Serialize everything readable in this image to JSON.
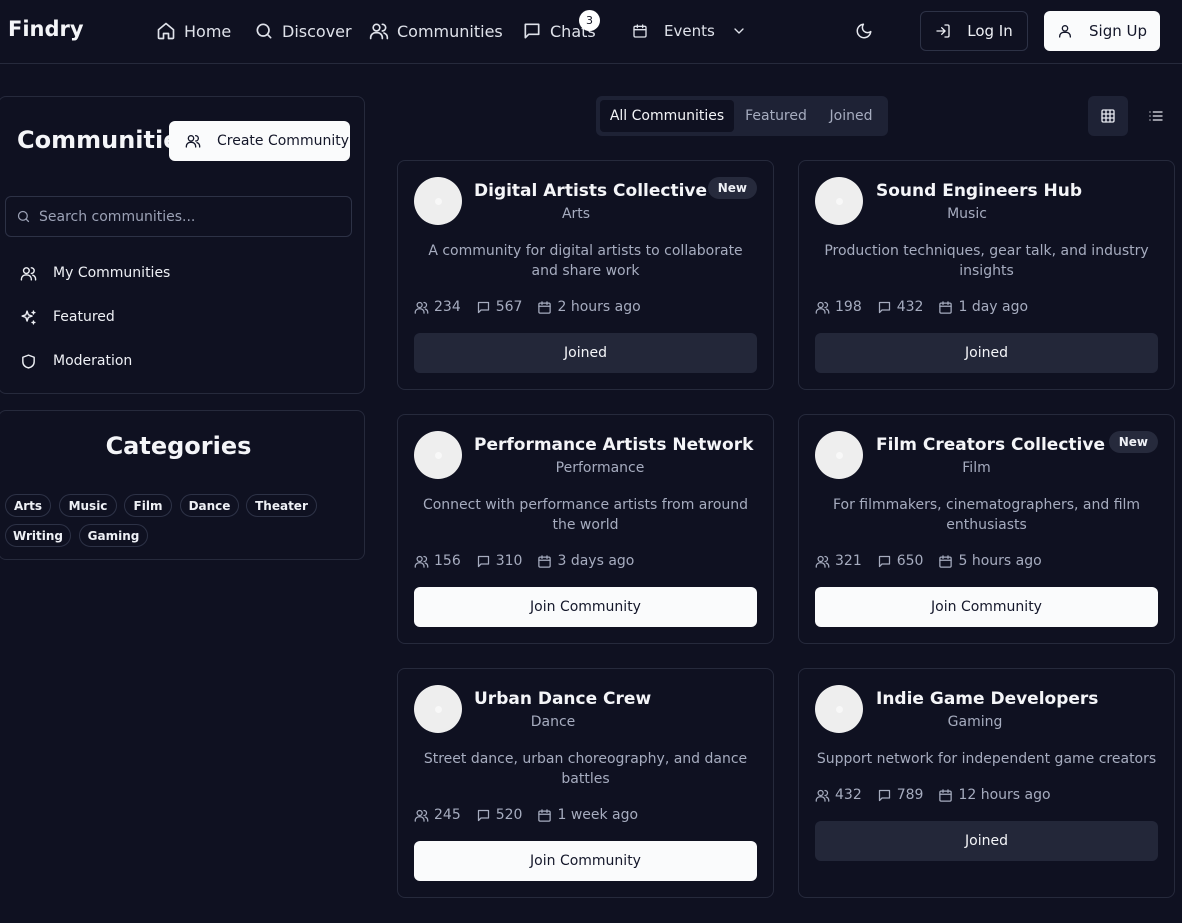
{
  "brand": "Findry",
  "nav": {
    "home": "Home",
    "discover": "Discover",
    "communities": "Communities",
    "chats": "Chats",
    "chats_badge": "3",
    "events": "Events"
  },
  "auth": {
    "login": "Log In",
    "signup": "Sign Up"
  },
  "sidebar": {
    "title": "Communities",
    "create_button": "Create Community",
    "search_placeholder": "Search communities...",
    "items": [
      {
        "label": "My Communities",
        "icon": "users-icon"
      },
      {
        "label": "Featured",
        "icon": "sparkles-icon"
      },
      {
        "label": "Moderation",
        "icon": "shield-icon"
      }
    ]
  },
  "categories": {
    "title": "Categories",
    "chips": [
      "Arts",
      "Music",
      "Film",
      "Dance",
      "Theater",
      "Writing",
      "Gaming"
    ]
  },
  "tabs": [
    "All Communities",
    "Featured",
    "Joined"
  ],
  "active_tab": "All Communities",
  "view_mode": "grid",
  "cards": [
    {
      "name": "Digital Artists Collective",
      "category": "Arts",
      "new": "New",
      "description": "A community for digital artists to collaborate and share work",
      "members": "234",
      "posts": "567",
      "time": "2 hours ago",
      "button": "Joined",
      "joined": true
    },
    {
      "name": "Sound Engineers Hub",
      "category": "Music",
      "new": "",
      "description": "Production techniques, gear talk, and industry insights",
      "members": "198",
      "posts": "432",
      "time": "1 day ago",
      "button": "Joined",
      "joined": true
    },
    {
      "name": "Performance Artists Network",
      "category": "Performance",
      "new": "",
      "description": "Connect with performance artists from around the world",
      "members": "156",
      "posts": "310",
      "time": "3 days ago",
      "button": "Join Community",
      "joined": false
    },
    {
      "name": "Film Creators Collective",
      "category": "Film",
      "new": "New",
      "description": "For filmmakers, cinematographers, and film enthusiasts",
      "members": "321",
      "posts": "650",
      "time": "5 hours ago",
      "button": "Join Community",
      "joined": false
    },
    {
      "name": "Urban Dance Crew",
      "category": "Dance",
      "new": "",
      "description": "Street dance, urban choreography, and dance battles",
      "members": "245",
      "posts": "520",
      "time": "1 week ago",
      "button": "Join Community",
      "joined": false
    },
    {
      "name": "Indie Game Developers",
      "category": "Gaming",
      "new": "",
      "description": "Support network for independent game creators",
      "members": "432",
      "posts": "789",
      "time": "12 hours ago",
      "button": "Joined",
      "joined": true
    }
  ],
  "colors": {
    "background": "#0f1121",
    "border": "#262a3c",
    "muted_text": "#a6acbf",
    "button_light": "#fafbfc",
    "button_dark": "#232739"
  }
}
